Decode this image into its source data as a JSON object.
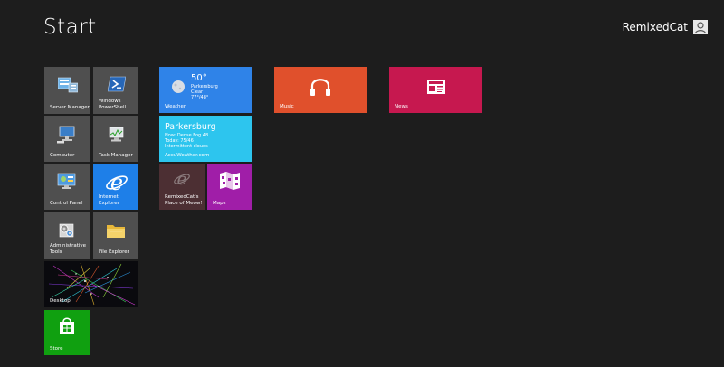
{
  "screen": {
    "title": "Start"
  },
  "user": {
    "name": "RemixedCat",
    "icon": "user-icon"
  },
  "tiles": {
    "server_manager": {
      "label": "Server Manager",
      "icon": "server-manager-icon"
    },
    "powershell": {
      "label": "Windows\nPowerShell",
      "icon": "powershell-icon"
    },
    "computer": {
      "label": "Computer",
      "icon": "computer-icon"
    },
    "task_manager": {
      "label": "Task Manager",
      "icon": "task-manager-icon"
    },
    "control_panel": {
      "label": "Control Panel",
      "icon": "control-panel-icon"
    },
    "internet_explorer": {
      "label": "Internet Explorer",
      "icon": "ie-icon"
    },
    "admin_tools": {
      "label": "Administrative\nTools",
      "icon": "admin-tools-icon"
    },
    "file_explorer": {
      "label": "File Explorer",
      "icon": "folder-icon"
    },
    "desktop": {
      "label": "Desktop"
    },
    "store": {
      "label": "Store",
      "icon": "store-bag-icon"
    },
    "weather": {
      "label": "Weather",
      "temp": "50°",
      "lines": "Parkersburg\nClear\n77°/48°",
      "icon": "moon-icon"
    },
    "accuweather": {
      "label": "AccuWeather.com",
      "city": "Parkersburg",
      "lines": "Now: Dense Fog 48\nToday: 75/46\nIntermittent clouds"
    },
    "remixedcat_site": {
      "label": "RemixedCat's\nPlace of Meow!",
      "icon": "ie-site-icon"
    },
    "maps": {
      "label": "Maps",
      "icon": "map-icon"
    },
    "music": {
      "label": "Music",
      "icon": "headphones-icon"
    },
    "news": {
      "label": "News",
      "icon": "newspaper-icon"
    }
  },
  "colors": {
    "background": "#1d1d1d",
    "gray_tile": "#4f4f4f",
    "weather": "#2f83e8",
    "accuweather": "#2dc5ee",
    "ie": "#1e7fe8",
    "site": "#4c2f33",
    "maps": "#a01ea8",
    "music": "#e0502c",
    "news": "#c6184f",
    "store": "#10a010"
  }
}
